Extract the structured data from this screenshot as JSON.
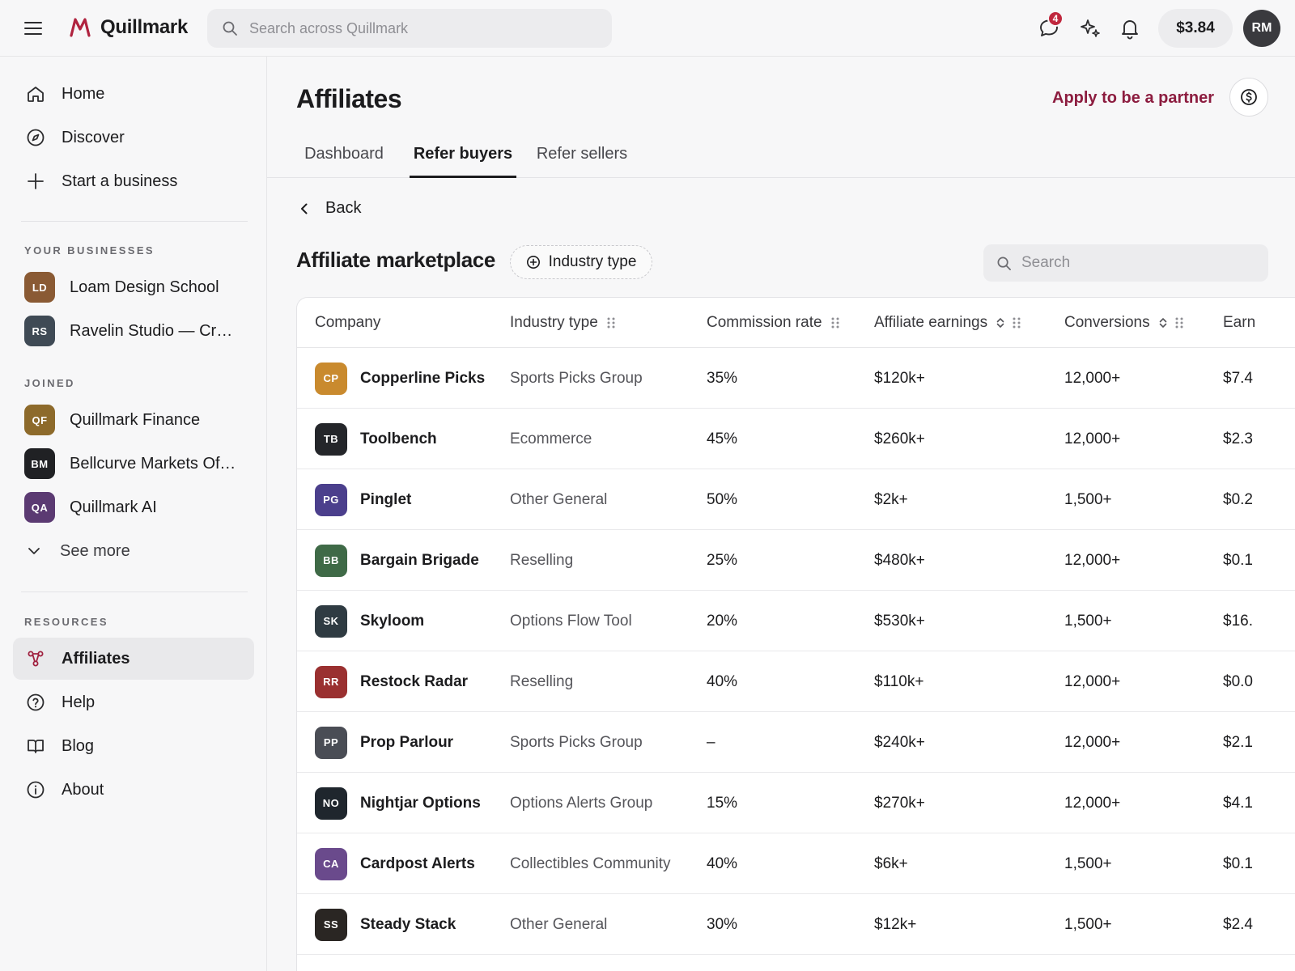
{
  "app": {
    "name": "Quillmark"
  },
  "topbar": {
    "search_placeholder": "Search across Quillmark",
    "messages_badge": "4",
    "balance": "$3.84",
    "avatar_initials": "RM"
  },
  "sidebar": {
    "nav": [
      {
        "label": "Home",
        "icon": "home-icon"
      },
      {
        "label": "Discover",
        "icon": "compass-icon"
      },
      {
        "label": "Start a business",
        "icon": "plus-icon"
      }
    ],
    "your_businesses_label": "YOUR BUSINESSES",
    "your_businesses": [
      {
        "initials": "LD",
        "name": "Loam Design School",
        "color": "#8a5a34"
      },
      {
        "initials": "RS",
        "name": "Ravelin Studio — Creative",
        "color": "#3f4a55"
      }
    ],
    "joined_label": "JOINED",
    "joined": [
      {
        "initials": "QF",
        "name": "Quillmark Finance",
        "color": "#8d6a2b"
      },
      {
        "initials": "BM",
        "name": "Bellcurve Markets Official",
        "color": "#202124"
      },
      {
        "initials": "QA",
        "name": "Quillmark AI",
        "color": "#5b3a72"
      }
    ],
    "see_more_label": "See more",
    "resources_label": "RESOURCES",
    "resources": [
      {
        "label": "Affiliates",
        "icon": "affiliates-icon",
        "active": true
      },
      {
        "label": "Help",
        "icon": "help-icon",
        "active": false
      },
      {
        "label": "Blog",
        "icon": "book-icon",
        "active": false
      },
      {
        "label": "About",
        "icon": "info-icon",
        "active": false
      }
    ]
  },
  "page": {
    "title": "Affiliates",
    "partner_link": "Apply to be a partner",
    "tabs": [
      {
        "label": "Dashboard",
        "active": false
      },
      {
        "label": "Refer buyers",
        "active": true
      },
      {
        "label": "Refer sellers",
        "active": false
      }
    ],
    "back_label": "Back",
    "section_title": "Affiliate marketplace",
    "filter_label": "Industry type",
    "search_placeholder": "Search"
  },
  "table": {
    "columns": [
      "Company",
      "Industry type",
      "Commission rate",
      "Affiliate earnings",
      "Conversions",
      "Earn"
    ],
    "rows": [
      {
        "initials": "CP",
        "color": "#c98a2e",
        "company": "Copperline Picks",
        "industry": "Sports Picks Group",
        "commission": "35%",
        "earnings": "$120k+",
        "conversions": "12,000+",
        "earn": "$7.4"
      },
      {
        "initials": "TB",
        "color": "#24262a",
        "company": "Toolbench",
        "industry": "Ecommerce",
        "commission": "45%",
        "earnings": "$260k+",
        "conversions": "12,000+",
        "earn": "$2.3"
      },
      {
        "initials": "PG",
        "color": "#4b3f8c",
        "company": "Pinglet",
        "industry": "Other General",
        "commission": "50%",
        "earnings": "$2k+",
        "conversions": "1,500+",
        "earn": "$0.2"
      },
      {
        "initials": "BB",
        "color": "#3f6a47",
        "company": "Bargain Brigade",
        "industry": "Reselling",
        "commission": "25%",
        "earnings": "$480k+",
        "conversions": "12,000+",
        "earn": "$0.1"
      },
      {
        "initials": "SK",
        "color": "#2f3b42",
        "company": "Skyloom",
        "industry": "Options Flow Tool",
        "commission": "20%",
        "earnings": "$530k+",
        "conversions": "1,500+",
        "earn": "$16."
      },
      {
        "initials": "RR",
        "color": "#9a3030",
        "company": "Restock Radar",
        "industry": "Reselling",
        "commission": "40%",
        "earnings": "$110k+",
        "conversions": "12,000+",
        "earn": "$0.0"
      },
      {
        "initials": "PP",
        "color": "#4a4d55",
        "company": "Prop Parlour",
        "industry": "Sports Picks Group",
        "commission": "–",
        "earnings": "$240k+",
        "conversions": "12,000+",
        "earn": "$2.1"
      },
      {
        "initials": "NO",
        "color": "#1f262d",
        "company": "Nightjar Options",
        "industry": "Options Alerts Group",
        "commission": "15%",
        "earnings": "$270k+",
        "conversions": "12,000+",
        "earn": "$4.1"
      },
      {
        "initials": "CA",
        "color": "#6a4a8c",
        "company": "Cardpost Alerts",
        "industry": "Collectibles Community",
        "commission": "40%",
        "earnings": "$6k+",
        "conversions": "1,500+",
        "earn": "$0.1"
      },
      {
        "initials": "SS",
        "color": "#2a2623",
        "company": "Steady Stack",
        "industry": "Other General",
        "commission": "30%",
        "earnings": "$12k+",
        "conversions": "1,500+",
        "earn": "$2.4"
      }
    ]
  },
  "colors": {
    "accent": "#8c1c3f",
    "logo": "#b0233f",
    "badge": "#c0273d"
  }
}
